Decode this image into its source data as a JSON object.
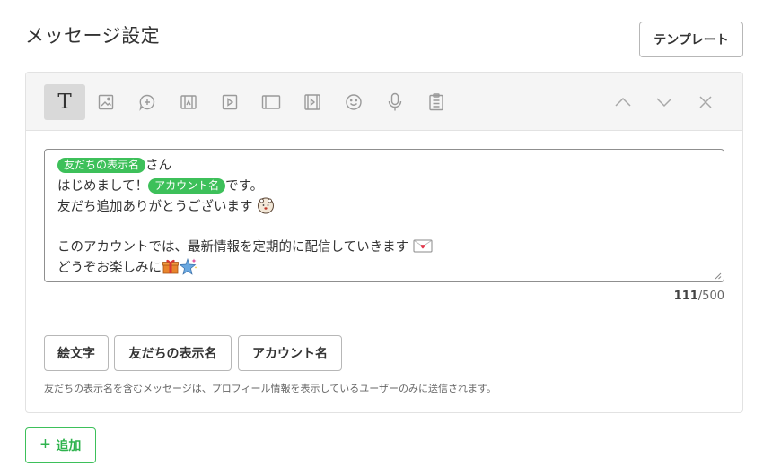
{
  "page": {
    "title": "メッセージ設定",
    "template_label": "テンプレート"
  },
  "toolbar": {
    "tools": [
      {
        "icon": "text-icon",
        "glyph": "T",
        "active": true
      },
      {
        "icon": "image-icon"
      },
      {
        "icon": "stamp-icon"
      },
      {
        "icon": "image-map-icon"
      },
      {
        "icon": "video-icon"
      },
      {
        "icon": "card-icon"
      },
      {
        "icon": "rich-video-icon"
      },
      {
        "icon": "emoji-icon"
      },
      {
        "icon": "voice-icon"
      },
      {
        "icon": "survey-icon"
      }
    ],
    "right_controls": [
      "move-up-icon",
      "move-down-icon",
      "close-icon"
    ]
  },
  "message": {
    "line1": {
      "tag": "友だちの表示名",
      "text": "さん"
    },
    "line2": {
      "pre": "はじめまして！",
      "tag": "アカウント名",
      "post": "です。"
    },
    "line3": {
      "text": "友だち追加ありがとうございます",
      "emoji": "bear-emoji"
    },
    "line4": {
      "text": ""
    },
    "line5": {
      "text": "このアカウントでは、最新情報を定期的に配信していきます",
      "emoji": "letter-emoji"
    },
    "line6": {
      "text": "どうぞお楽しみに",
      "emoji": [
        "gift-emoji",
        "sparkle-star-emoji"
      ]
    }
  },
  "counter": {
    "current": "111",
    "max": "/500"
  },
  "variables": {
    "emoji_label": "絵文字",
    "friend_name_label": "友だちの表示名",
    "account_name_label": "アカウント名"
  },
  "note": "友だちの表示名を含むメッセージは、プロフィール情報を表示しているユーザーのみに送信されます。",
  "add": {
    "label": "追加"
  },
  "colors": {
    "accent": "#3dc05a",
    "toolbar_bg": "#f5f5f5",
    "border": "#e2e2e2",
    "text": "#333333"
  }
}
